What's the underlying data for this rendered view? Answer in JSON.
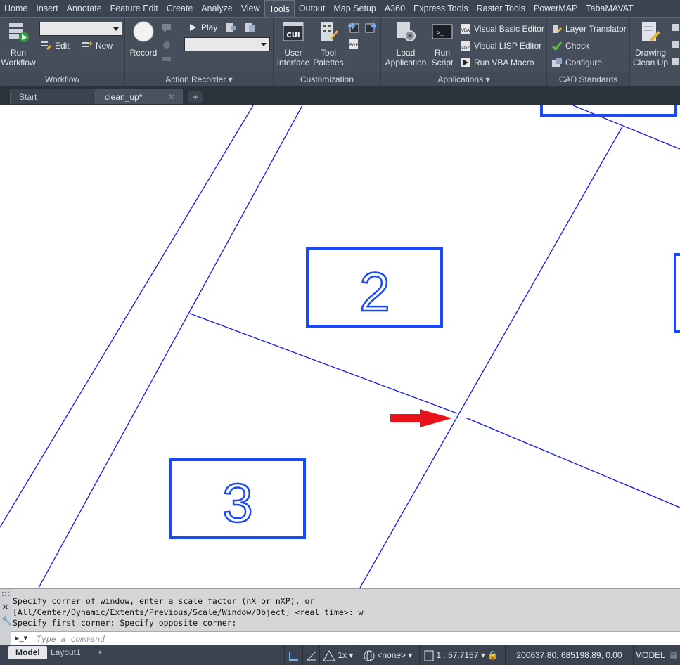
{
  "menubar": {
    "tabs": [
      "Home",
      "Insert",
      "Annotate",
      "Feature Edit",
      "Create",
      "Analyze",
      "View",
      "Tools",
      "Output",
      "Map Setup",
      "A360",
      "Express Tools",
      "Raster Tools",
      "PowerMAP",
      "TabaMAVAT"
    ],
    "active_tab": "Tools"
  },
  "ribbon": {
    "workflow": {
      "title": "Workflow",
      "run_label_1": "Run",
      "run_label_2": "Workflow",
      "edit": "Edit",
      "new": "New"
    },
    "action_recorder": {
      "title": "Action Recorder",
      "record": "Record",
      "play": "Play"
    },
    "customization": {
      "title": "Customization",
      "user_interface_1": "User",
      "user_interface_2": "Interface",
      "tool_palettes_1": "Tool",
      "tool_palettes_2": "Palettes"
    },
    "applications": {
      "title": "Applications",
      "load_app_1": "Load",
      "load_app_2": "Application",
      "run_script_1": "Run",
      "run_script_2": "Script",
      "vb_editor": "Visual Basic Editor",
      "vlisp_editor": "Visual LISP Editor",
      "run_vba": "Run VBA Macro"
    },
    "cad_standards": {
      "title": "CAD Standards",
      "layer_translator": "Layer Translator",
      "check": "Check",
      "configure": "Configure"
    },
    "drawing_cleanup": {
      "label_1": "Drawing",
      "label_2": "Clean Up"
    }
  },
  "doc_tabs": {
    "start": "Start",
    "active": "clean_up*"
  },
  "canvas": {
    "box_labels": [
      "2",
      "3"
    ]
  },
  "command": {
    "history": [
      "Specify corner of window, enter a scale factor (nX or nXP), or",
      "[All/Center/Dynamic/Extents/Previous/Scale/Window/Object] <real time>: w",
      "Specify first corner: Specify opposite corner:"
    ],
    "placeholder": "Type a command"
  },
  "status": {
    "layout_tabs": [
      "Model",
      "Layout1"
    ],
    "scale_factor": "1x",
    "osnap": "<none>",
    "scale": "1 : 57.7157",
    "coords": "200637.80, 685198.89, 0.00",
    "space": "MODEL"
  },
  "colors": {
    "line": "#1515e6",
    "box": "#1848ff",
    "arrow": "#e8131b",
    "menubar": "#3b4453",
    "ribbon": "#474e5b"
  }
}
